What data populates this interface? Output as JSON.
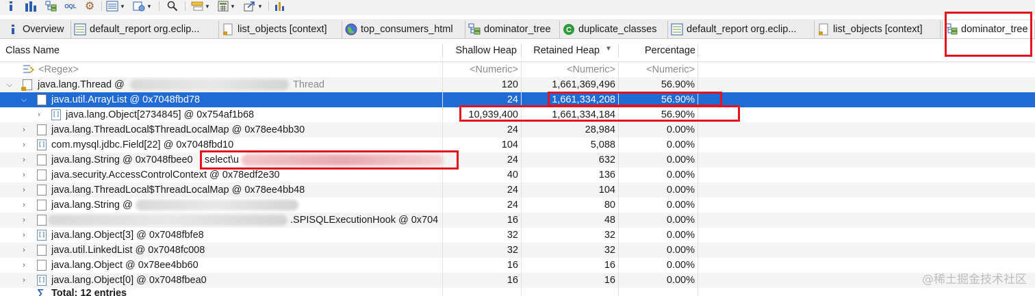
{
  "toolbar": {
    "buttons": [
      {
        "name": "info-icon",
        "glyph": "i"
      },
      {
        "name": "histogram-icon",
        "glyph": "▮"
      },
      {
        "name": "class-tree-icon",
        "glyph": "⊞"
      },
      {
        "name": "oql-icon",
        "glyph": "OQL"
      },
      {
        "name": "gears-icon",
        "glyph": "⚙"
      },
      {
        "name": "query-browser-icon",
        "glyph": "▤"
      },
      {
        "name": "run-report-icon",
        "glyph": "⚙"
      },
      {
        "name": "search-icon",
        "glyph": "🔍"
      },
      {
        "name": "group-by-icon",
        "glyph": "▭"
      },
      {
        "name": "calculator-icon",
        "glyph": "▦"
      },
      {
        "name": "export-icon",
        "glyph": "↗"
      },
      {
        "name": "pie-chart-icon",
        "glyph": "◔"
      }
    ]
  },
  "tabs": [
    {
      "label": "Overview",
      "icon": "info-icon"
    },
    {
      "label": "default_report  org.eclip...",
      "icon": "report-icon"
    },
    {
      "label": "list_objects  [context]",
      "icon": "list-objects-icon"
    },
    {
      "label": "top_consumers_html",
      "icon": "globe-icon"
    },
    {
      "label": "dominator_tree",
      "icon": "dominator-tree-icon"
    },
    {
      "label": "duplicate_classes",
      "icon": "duplicate-classes-icon"
    },
    {
      "label": "default_report  org.eclip...",
      "icon": "report-icon"
    },
    {
      "label": "list_objects  [context]",
      "icon": "list-objects-icon"
    },
    {
      "label": "dominator_tree",
      "icon": "dominator-tree-icon"
    }
  ],
  "columns": {
    "class_name": "Class Name",
    "shallow_heap": "Shallow Heap",
    "retained_heap": "Retained Heap",
    "retained_sort_indicator": "▼",
    "percentage": "Percentage"
  },
  "filter_row": {
    "class_name": "<Regex>",
    "shallow_heap": "<Numeric>",
    "retained_heap": "<Numeric>",
    "percentage": "<Numeric>"
  },
  "rows": [
    {
      "indent": 0,
      "expand": "open",
      "icon": "thread",
      "name": "java.lang.Thread @",
      "name_tail": "Thread",
      "shallow": "120",
      "retained": "1,661,369,496",
      "percent": "56.90%"
    },
    {
      "indent": 1,
      "expand": "open",
      "icon": "doc",
      "name": "java.util.ArrayList @ 0x7048fbd78",
      "shallow": "24",
      "retained": "1,661,334,208",
      "percent": "56.90%",
      "selected": true
    },
    {
      "indent": 2,
      "expand": "closed",
      "icon": "array",
      "name": "java.lang.Object[2734845] @ 0x754af1b68",
      "shallow": "10,939,400",
      "retained": "1,661,334,184",
      "percent": "56.90%"
    },
    {
      "indent": 1,
      "expand": "closed",
      "icon": "doc",
      "name": "java.lang.ThreadLocal$ThreadLocalMap @ 0x78ee4bb30",
      "shallow": "24",
      "retained": "28,984",
      "percent": "0.00%"
    },
    {
      "indent": 1,
      "expand": "closed",
      "icon": "array",
      "name": "com.mysql.jdbc.Field[22] @ 0x7048fbd10",
      "shallow": "104",
      "retained": "5,088",
      "percent": "0.00%"
    },
    {
      "indent": 1,
      "expand": "closed",
      "icon": "doc",
      "name": "java.lang.String @ 0x7048fbee0",
      "name_tail": "select\\u",
      "shallow": "24",
      "retained": "632",
      "percent": "0.00%"
    },
    {
      "indent": 1,
      "expand": "closed",
      "icon": "doc",
      "name": "java.security.AccessControlContext @ 0x78edf2e30",
      "shallow": "40",
      "retained": "136",
      "percent": "0.00%"
    },
    {
      "indent": 1,
      "expand": "closed",
      "icon": "doc",
      "name": "java.lang.ThreadLocal$ThreadLocalMap @ 0x78ee4bb48",
      "shallow": "24",
      "retained": "104",
      "percent": "0.00%"
    },
    {
      "indent": 1,
      "expand": "closed",
      "icon": "doc",
      "name": "java.lang.String @",
      "shallow": "24",
      "retained": "80",
      "percent": "0.00%"
    },
    {
      "indent": 1,
      "expand": "closed",
      "icon": "doc",
      "name": "",
      "name_tail": ".SPISQLExecutionHook @ 0x704",
      "shallow": "16",
      "retained": "48",
      "percent": "0.00%"
    },
    {
      "indent": 1,
      "expand": "closed",
      "icon": "array",
      "name": "java.lang.Object[3] @ 0x7048fbfe8",
      "shallow": "32",
      "retained": "32",
      "percent": "0.00%"
    },
    {
      "indent": 1,
      "expand": "closed",
      "icon": "doc",
      "name": "java.util.LinkedList @ 0x7048fc008",
      "shallow": "32",
      "retained": "32",
      "percent": "0.00%"
    },
    {
      "indent": 1,
      "expand": "closed",
      "icon": "doc",
      "name": "java.lang.Object @ 0x78ee4bb60",
      "shallow": "16",
      "retained": "16",
      "percent": "0.00%"
    },
    {
      "indent": 1,
      "expand": "closed",
      "icon": "array",
      "name": "java.lang.Object[0] @ 0x7048fbea0",
      "shallow": "16",
      "retained": "16",
      "percent": "0.00%"
    }
  ],
  "total": {
    "glyph": "∑",
    "label": "Total: 12 entries"
  },
  "watermark": "@稀土掘金技术社区",
  "colors": {
    "selection": "#1f6bd6",
    "highlight_box": "#e3121b"
  }
}
